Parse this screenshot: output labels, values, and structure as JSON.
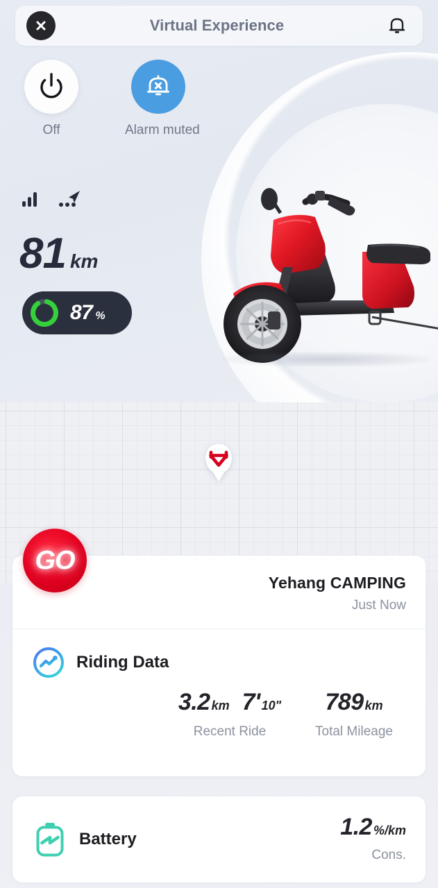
{
  "header": {
    "title": "Virtual Experience",
    "close_icon": "close-icon",
    "bell_icon": "bell-icon"
  },
  "quick_actions": [
    {
      "label": "Off",
      "icon": "power-icon",
      "state": "inactive"
    },
    {
      "label": "Alarm muted",
      "icon": "bell-muted-icon",
      "state": "active",
      "color": "#4a9de0"
    }
  ],
  "status": {
    "signal_icon": "signal-bars-icon",
    "gps_icon": "gps-arrow-icon"
  },
  "range": {
    "value": "81",
    "unit": "km"
  },
  "battery_pill": {
    "percent": "87",
    "percent_symbol": "%",
    "percent_number": 87,
    "ring_color": "#34d13b",
    "pill_color": "#2b303e"
  },
  "map": {
    "pin_icon": "vehicle-location-pin-icon",
    "pin_logo_color": "#d8001f"
  },
  "go_badge": {
    "label": "GO",
    "color": "#e2001f"
  },
  "vehicle_card": {
    "name": "Yehang CAMPING",
    "time": "Just Now",
    "riding_data": {
      "icon": "riding-data-icon",
      "label": "Riding Data",
      "stats": [
        {
          "caption": "Recent Ride",
          "values": [
            {
              "number": "3.2",
              "unit": "km"
            },
            {
              "number": "7'",
              "unit": "10\""
            }
          ]
        },
        {
          "caption": "Total Mileage",
          "values": [
            {
              "number": "789",
              "unit": "km"
            }
          ]
        }
      ]
    }
  },
  "battery_card": {
    "icon": "battery-bolt-icon",
    "label": "Battery",
    "value": "1.2",
    "unit": "%/km",
    "caption": "Cons.",
    "icon_color": "#3ecfaf"
  }
}
